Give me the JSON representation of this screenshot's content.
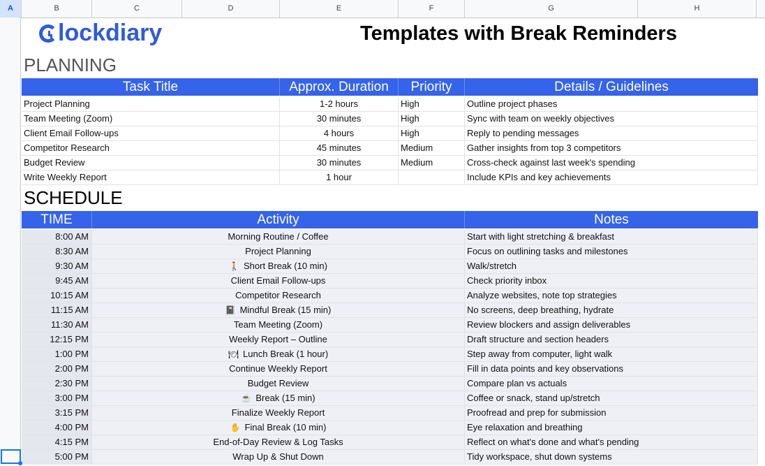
{
  "columns": [
    "A",
    "B",
    "C",
    "D",
    "E",
    "F",
    "G",
    "H"
  ],
  "brand": "Clockdiary",
  "brand_rest": "lockdiary",
  "title": "Templates with Break Reminders",
  "planning": {
    "heading": "PLANNING",
    "headers": [
      "Task Title",
      "Approx. Duration",
      "Priority",
      "Details / Guidelines"
    ],
    "rows": [
      [
        "Project Planning",
        "1-2 hours",
        "High",
        "Outline project phases"
      ],
      [
        "Team Meeting (Zoom)",
        "30 minutes",
        "High",
        "Sync with team on weekly objectives"
      ],
      [
        "Client Email Follow-ups",
        "4 hours",
        "High",
        "Reply to pending messages"
      ],
      [
        "Competitor Research",
        "45 minutes",
        "Medium",
        "Gather insights from top 3 competitors"
      ],
      [
        "Budget Review",
        "30 minutes",
        "Medium",
        "Cross-check against last week's spending"
      ],
      [
        "Write Weekly Report",
        "1 hour",
        "",
        "Include KPIs and key achievements"
      ]
    ]
  },
  "schedule": {
    "heading": "SCHEDULE",
    "headers": [
      "TIME",
      "Activity",
      "Notes"
    ],
    "rows": [
      {
        "time": "8:00 AM",
        "icon": "",
        "activity": "Morning Routine / Coffee",
        "notes": "Start with light stretching & breakfast"
      },
      {
        "time": "8:30 AM",
        "icon": "",
        "activity": "Project Planning",
        "notes": "Focus on outlining tasks and milestones"
      },
      {
        "time": "9:30 AM",
        "icon": "🚶",
        "activity": "Short Break (10 min)",
        "notes": "Walk/stretch"
      },
      {
        "time": "9:45 AM",
        "icon": "",
        "activity": "Client Email Follow-ups",
        "notes": "Check priority inbox"
      },
      {
        "time": "10:15 AM",
        "icon": "",
        "activity": "Competitor Research",
        "notes": "Analyze websites, note top strategies"
      },
      {
        "time": "11:15 AM",
        "icon": "📓",
        "activity": "Mindful Break (15 min)",
        "notes": "No screens, deep breathing, hydrate"
      },
      {
        "time": "11:30 AM",
        "icon": "",
        "activity": "Team Meeting (Zoom)",
        "notes": "Review blockers and assign deliverables"
      },
      {
        "time": "12:15 PM",
        "icon": "",
        "activity": "Weekly Report – Outline",
        "notes": "Draft structure and section headers"
      },
      {
        "time": "1:00 PM",
        "icon": "🍽",
        "activity": "Lunch Break (1 hour)",
        "notes": "Step away from computer, light walk"
      },
      {
        "time": "2:00 PM",
        "icon": "",
        "activity": "Continue Weekly Report",
        "notes": "Fill in data points and key observations"
      },
      {
        "time": "2:30 PM",
        "icon": "",
        "activity": "Budget Review",
        "notes": "Compare plan vs actuals"
      },
      {
        "time": "3:00 PM",
        "icon": "☕",
        "activity": "Break (15 min)",
        "notes": "Coffee or snack, stand up/stretch"
      },
      {
        "time": "3:15 PM",
        "icon": "",
        "activity": "Finalize Weekly Report",
        "notes": "Proofread and prep for submission"
      },
      {
        "time": "4:00 PM",
        "icon": "✋",
        "activity": "Final Break (10 min)",
        "notes": "Eye relaxation and breathing"
      },
      {
        "time": "4:15 PM",
        "icon": "",
        "activity": "End-of-Day Review & Log Tasks",
        "notes": "Reflect on what's done and what's pending"
      },
      {
        "time": "5:00 PM",
        "icon": "",
        "activity": "Wrap Up & Shut Down",
        "notes": "Tidy workspace, shut down systems"
      }
    ]
  },
  "colors": {
    "header_blue": "#3563e9",
    "brand_blue": "#2f5bd8",
    "schedule_bg": "#eef0f6"
  }
}
